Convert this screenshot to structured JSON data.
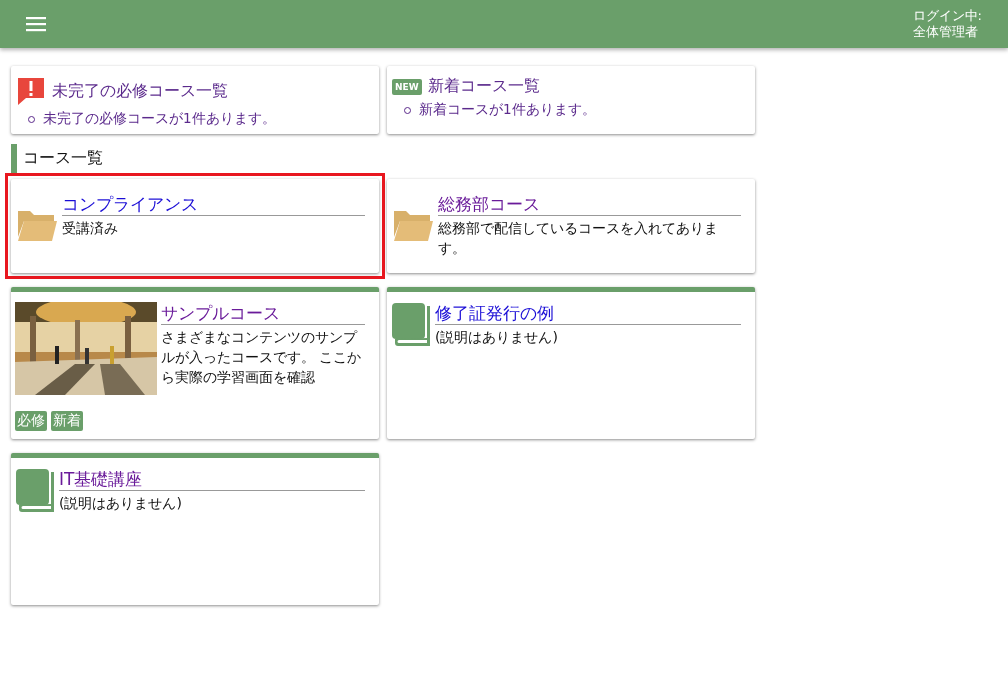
{
  "header": {
    "login_label": "ログイン中:",
    "user": "全体管理者"
  },
  "notices": [
    {
      "kind": "alert",
      "title": "未完了の必修コース一覧",
      "items": [
        "未完了の必修コースが1件あります。"
      ]
    },
    {
      "kind": "new",
      "badge": "NEW",
      "title": "新着コース一覧",
      "items": [
        "新着コースが1件あります。"
      ]
    }
  ],
  "section_title": "コース一覧",
  "courses": [
    {
      "kind": "folder",
      "title": "コンプライアンス",
      "visited": false,
      "highlighted": true,
      "description": "受講済み"
    },
    {
      "kind": "folder",
      "title": "総務部コース",
      "visited": true,
      "highlighted": false,
      "description": "総務部で配信しているコースを入れてあります。"
    },
    {
      "kind": "picture",
      "title": "サンプルコース",
      "visited": true,
      "highlighted": false,
      "description": "さまざまなコンテンツのサンプルが入ったコースです。 ここから実際の学習画面を確認",
      "tags": [
        "必修",
        "新着"
      ]
    },
    {
      "kind": "book",
      "title": "修了証発行の例",
      "visited": false,
      "highlighted": false,
      "description": "(説明はありません)"
    },
    {
      "kind": "book",
      "title": "IT基礎講座",
      "visited": true,
      "highlighted": false,
      "description": "(説明はありません)"
    }
  ]
}
